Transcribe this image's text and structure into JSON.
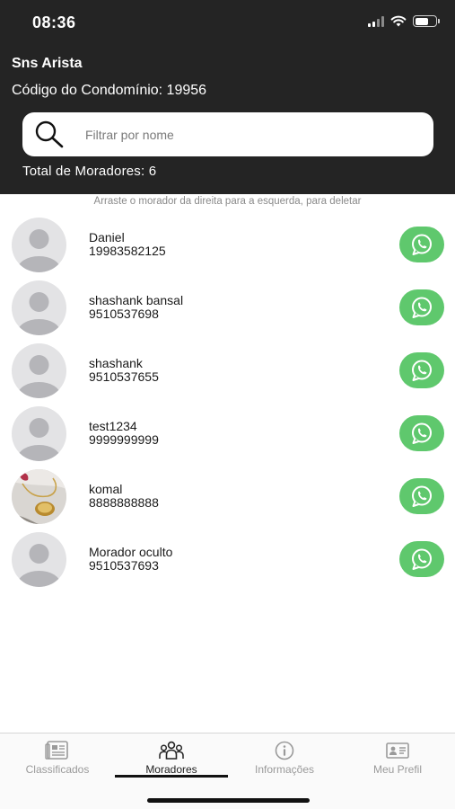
{
  "status_bar": {
    "time": "08:36"
  },
  "header": {
    "condo_name": "Sns Arista",
    "condo_code": "Código do Condomínio: 19956",
    "total_residents": "Total de Moradores: 6"
  },
  "search": {
    "placeholder": "Filtrar por nome",
    "value": ""
  },
  "hint": "Arraste o morador da direita para a esquerda, para deletar",
  "residents": [
    {
      "name": "Daniel",
      "phone": "19983582125",
      "avatar": "default-avatar-icon"
    },
    {
      "name": "shashank bansal",
      "phone": "9510537698",
      "avatar": "default-avatar-icon"
    },
    {
      "name": "shashank",
      "phone": "9510537655",
      "avatar": "default-avatar-icon"
    },
    {
      "name": "test1234",
      "phone": "9999999999",
      "avatar": "default-avatar-icon"
    },
    {
      "name": "komal",
      "phone": "8888888888",
      "avatar": "photo-avatar"
    },
    {
      "name": "Morador oculto",
      "phone": "9510537693",
      "avatar": "default-avatar-icon"
    }
  ],
  "tabs": [
    {
      "label": "Classificados",
      "icon": "newspaper-icon",
      "active": false
    },
    {
      "label": "Moradores",
      "icon": "group-icon",
      "active": true
    },
    {
      "label": "Informações",
      "icon": "info-icon",
      "active": false
    },
    {
      "label": "Meu Prefil",
      "icon": "id-card-icon",
      "active": false
    }
  ],
  "colors": {
    "header_bg": "#242424",
    "whatsapp_green": "#5fc86d",
    "avatar_bg": "#e3e3e5",
    "avatar_figure": "#b5b5b9"
  }
}
